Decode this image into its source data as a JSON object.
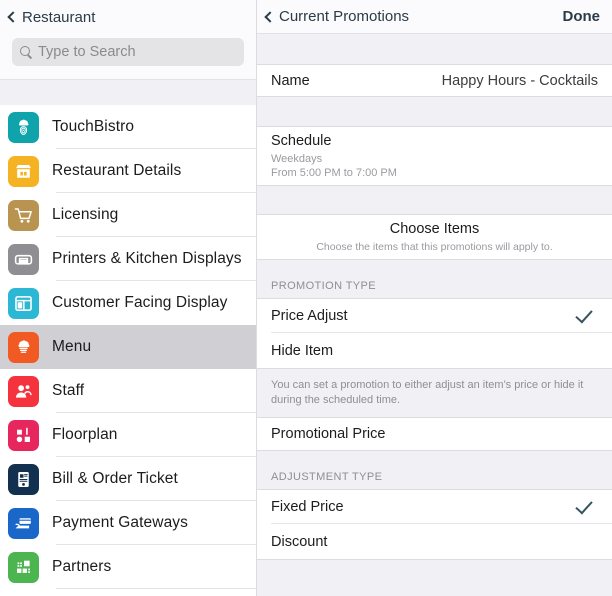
{
  "sidebar": {
    "back_label": "Restaurant",
    "search": {
      "placeholder": "Type to Search"
    },
    "items": [
      {
        "label": "TouchBistro",
        "icon": "chef-hat-fingerprint-icon",
        "color": "#0fa3ac"
      },
      {
        "label": "Restaurant Details",
        "icon": "storefront-icon",
        "color": "#f5b324"
      },
      {
        "label": "Licensing",
        "icon": "shopping-cart-icon",
        "color": "#b99451"
      },
      {
        "label": "Printers & Kitchen Displays",
        "icon": "printer-icon",
        "color": "#8e8e93"
      },
      {
        "label": "Customer Facing Display",
        "icon": "display-layout-icon",
        "color": "#2cb8d4"
      },
      {
        "label": "Menu",
        "icon": "chef-hat-icon",
        "color": "#f15a22",
        "selected": true
      },
      {
        "label": "Staff",
        "icon": "staff-people-icon",
        "color": "#f5333f"
      },
      {
        "label": "Floorplan",
        "icon": "floorplan-icon",
        "color": "#e8265e"
      },
      {
        "label": "Bill & Order Ticket",
        "icon": "bill-ticket-icon",
        "color": "#12304f"
      },
      {
        "label": "Payment Gateways",
        "icon": "credit-card-hand-icon",
        "color": "#1967c8"
      },
      {
        "label": "Partners",
        "icon": "partners-grid-icon",
        "color": "#4cb550"
      }
    ]
  },
  "detail": {
    "back_label": "Current Promotions",
    "done_label": "Done",
    "name_row": {
      "label": "Name",
      "value": "Happy Hours - Cocktails"
    },
    "schedule_row": {
      "title": "Schedule",
      "line1": "Weekdays",
      "line2": "From 5:00 PM to 7:00 PM"
    },
    "choose_items": {
      "title": "Choose Items",
      "subtitle": "Choose the items that this promotions will apply to."
    },
    "promotion_type": {
      "header": "PROMOTION TYPE",
      "options": [
        {
          "label": "Price Adjust",
          "checked": true
        },
        {
          "label": "Hide Item",
          "checked": false
        }
      ],
      "footnote": "You can set a promotion to either adjust an item's price or hide it during the scheduled time."
    },
    "promotional_price_row": {
      "label": "Promotional Price"
    },
    "adjustment_type": {
      "header": "ADJUSTMENT TYPE",
      "options": [
        {
          "label": "Fixed Price",
          "checked": true
        },
        {
          "label": "Discount",
          "checked": false
        }
      ]
    }
  },
  "colors": {
    "accent_check": "#37545f",
    "nav_text": "#2b3b47",
    "group_bg": "#f1f1f5"
  }
}
